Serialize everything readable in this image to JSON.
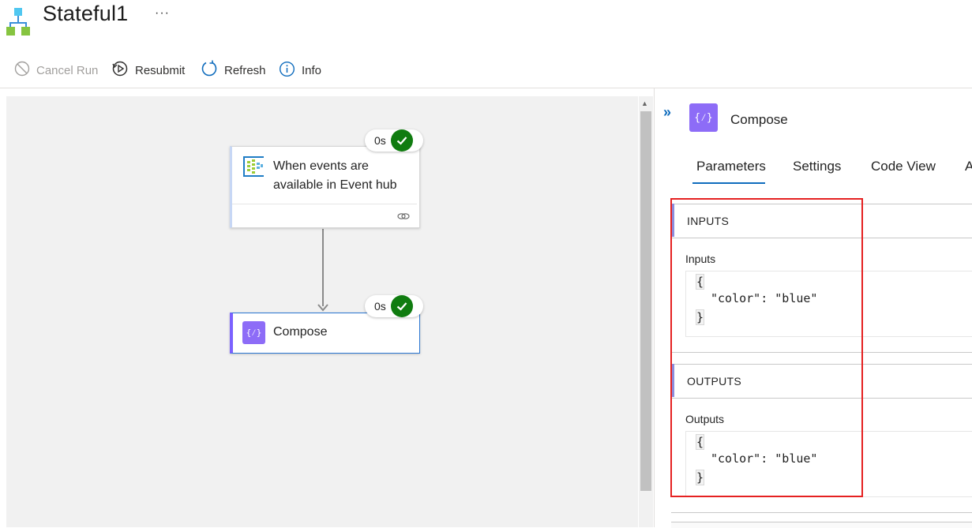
{
  "app": {
    "title": "Stateful1",
    "more_label": "···"
  },
  "toolbar": {
    "cancel_run": "Cancel Run",
    "resubmit": "Resubmit",
    "refresh": "Refresh",
    "info": "Info"
  },
  "designer": {
    "trigger": {
      "title": "When events are available in Event hub",
      "duration": "0s",
      "status": "succeeded"
    },
    "action": {
      "title": "Compose",
      "duration": "0s",
      "status": "succeeded"
    }
  },
  "panel": {
    "collapse_label": "»",
    "action_icon_label": "{⁄}",
    "title": "Compose",
    "tabs": [
      {
        "label": "Parameters",
        "selected": true
      },
      {
        "label": "Settings",
        "selected": false
      },
      {
        "label": "Code View",
        "selected": false
      },
      {
        "label": "A",
        "selected": false
      }
    ],
    "inputs_section": {
      "title": "INPUTS",
      "field_label": "Inputs",
      "open_brace": "{",
      "line": "\"color\": \"blue\"",
      "close_brace": "}"
    },
    "outputs_section": {
      "title": "OUTPUTS",
      "field_label": "Outputs",
      "open_brace": "{",
      "line": "\"color\": \"blue\"",
      "close_brace": "}"
    }
  },
  "colors": {
    "accent_blue": "#0f6cbd",
    "success_green": "#107c10",
    "compose_purple": "#7b61ff",
    "highlight_red": "#e52121"
  }
}
